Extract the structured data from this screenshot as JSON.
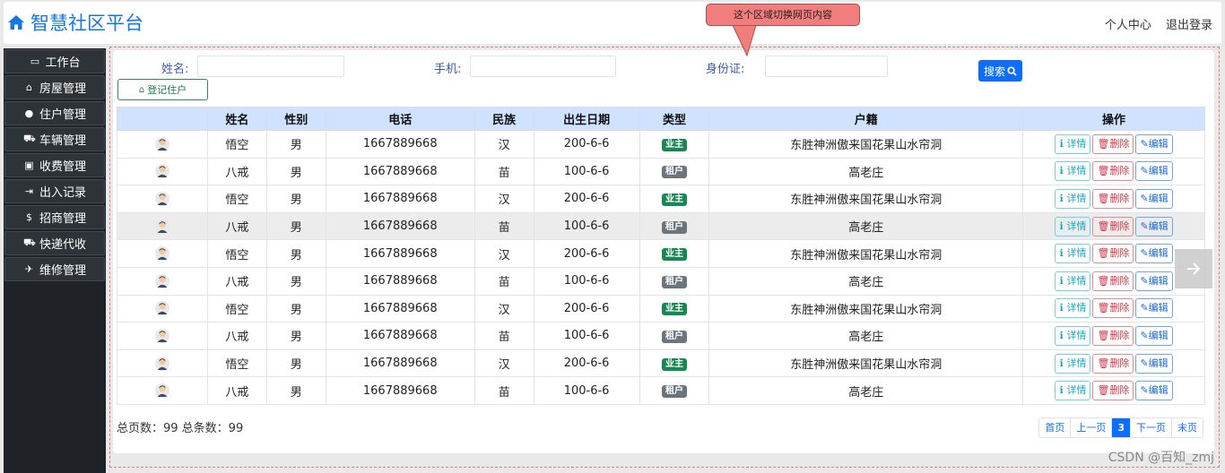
{
  "app": {
    "title": "智慧社区平台"
  },
  "header": {
    "links": [
      "个人中心",
      "退出登录"
    ]
  },
  "callout": {
    "text": "这个区域切换网页内容"
  },
  "sidebar": {
    "items": [
      {
        "icon": "monitor-icon",
        "glyph": "▭",
        "label": "工作台"
      },
      {
        "icon": "home-icon",
        "glyph": "⌂",
        "label": "房屋管理"
      },
      {
        "icon": "user-icon",
        "glyph": "●",
        "label": "住户管理"
      },
      {
        "icon": "car-icon",
        "glyph": "⛟",
        "label": "车辆管理"
      },
      {
        "icon": "money-icon",
        "glyph": "▣",
        "label": "收费管理"
      },
      {
        "icon": "signout-icon",
        "glyph": "⇥",
        "label": "出入记录"
      },
      {
        "icon": "dollar-icon",
        "glyph": "$",
        "label": "招商管理"
      },
      {
        "icon": "bus-icon",
        "glyph": "⛟",
        "label": "快递代收"
      },
      {
        "icon": "tools-icon",
        "glyph": "✈",
        "label": "维修管理"
      }
    ]
  },
  "search": {
    "name_label": "姓名:",
    "name_value": "",
    "phone_label": "手机:",
    "phone_value": "",
    "id_label": "身份证:",
    "id_value": "",
    "search_button": "搜索",
    "register_button": "登记住户"
  },
  "table": {
    "headers": [
      "",
      "姓名",
      "性别",
      "电话",
      "民族",
      "出生日期",
      "类型",
      "户籍",
      "操作"
    ],
    "rows": [
      {
        "name": "悟空",
        "gender": "男",
        "phone": "1667889668",
        "ethnicity": "汉",
        "birth": "200-6-6",
        "type": "业主",
        "type_kind": "owner",
        "hometown": "东胜神洲傲来国花果山水帘洞"
      },
      {
        "name": "八戒",
        "gender": "男",
        "phone": "1667889668",
        "ethnicity": "苗",
        "birth": "100-6-6",
        "type": "租户",
        "type_kind": "tenant",
        "hometown": "高老庄"
      },
      {
        "name": "悟空",
        "gender": "男",
        "phone": "1667889668",
        "ethnicity": "汉",
        "birth": "200-6-6",
        "type": "业主",
        "type_kind": "owner",
        "hometown": "东胜神洲傲来国花果山水帘洞"
      },
      {
        "name": "八戒",
        "gender": "男",
        "phone": "1667889668",
        "ethnicity": "苗",
        "birth": "100-6-6",
        "type": "租户",
        "type_kind": "tenant",
        "hometown": "高老庄",
        "highlighted": true
      },
      {
        "name": "悟空",
        "gender": "男",
        "phone": "1667889668",
        "ethnicity": "汉",
        "birth": "200-6-6",
        "type": "业主",
        "type_kind": "owner",
        "hometown": "东胜神洲傲来国花果山水帘洞"
      },
      {
        "name": "八戒",
        "gender": "男",
        "phone": "1667889668",
        "ethnicity": "苗",
        "birth": "100-6-6",
        "type": "租户",
        "type_kind": "tenant",
        "hometown": "高老庄"
      },
      {
        "name": "悟空",
        "gender": "男",
        "phone": "1667889668",
        "ethnicity": "汉",
        "birth": "200-6-6",
        "type": "业主",
        "type_kind": "owner",
        "hometown": "东胜神洲傲来国花果山水帘洞"
      },
      {
        "name": "八戒",
        "gender": "男",
        "phone": "1667889668",
        "ethnicity": "苗",
        "birth": "100-6-6",
        "type": "租户",
        "type_kind": "tenant",
        "hometown": "高老庄"
      },
      {
        "name": "悟空",
        "gender": "男",
        "phone": "1667889668",
        "ethnicity": "汉",
        "birth": "200-6-6",
        "type": "业主",
        "type_kind": "owner",
        "hometown": "东胜神洲傲来国花果山水帘洞"
      },
      {
        "name": "八戒",
        "gender": "男",
        "phone": "1667889668",
        "ethnicity": "苗",
        "birth": "100-6-6",
        "type": "租户",
        "type_kind": "tenant",
        "hometown": "高老庄"
      }
    ],
    "actions": {
      "detail": "详情",
      "delete": "删除",
      "edit": "编辑"
    }
  },
  "footer": {
    "totals_text": "总页数：99 总条数：99",
    "pager": [
      "首页",
      "上一页",
      "3",
      "下一页",
      "末页"
    ],
    "current_page": "3"
  },
  "watermark": "CSDN @百知_zmj",
  "colors": {
    "brand": "#1478e2",
    "sidebar_bg": "#1f2327",
    "primary": "#0d6efd",
    "owner": "#198754",
    "tenant": "#6c757d",
    "table_header": "#cfe2ff"
  }
}
